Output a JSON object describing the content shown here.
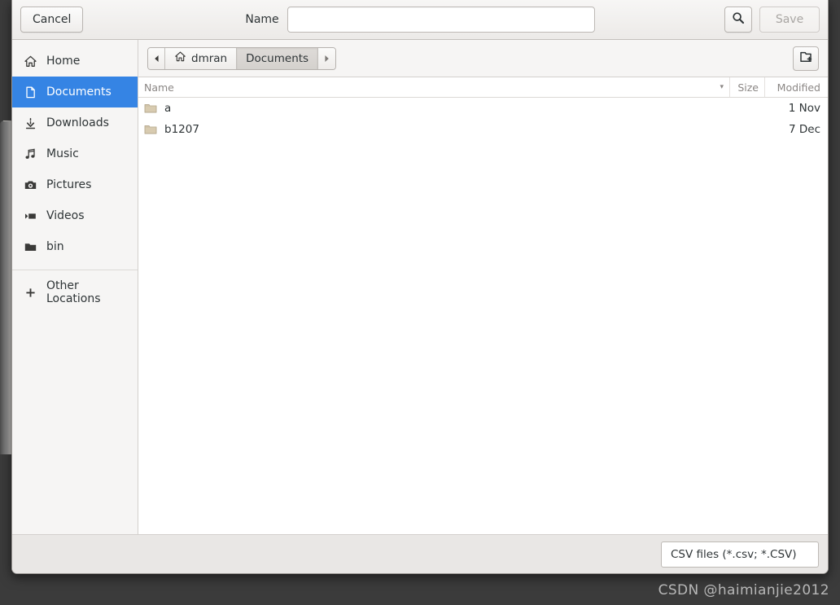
{
  "header": {
    "cancel_label": "Cancel",
    "name_label": "Name",
    "name_value": "",
    "name_placeholder": "",
    "search_icon": "search-icon",
    "save_label": "Save",
    "save_disabled": true
  },
  "sidebar": {
    "items": [
      {
        "label": "Home",
        "icon": "home-icon",
        "selected": false
      },
      {
        "label": "Documents",
        "icon": "document-icon",
        "selected": true
      },
      {
        "label": "Downloads",
        "icon": "download-icon",
        "selected": false
      },
      {
        "label": "Music",
        "icon": "music-note-icon",
        "selected": false
      },
      {
        "label": "Pictures",
        "icon": "camera-icon",
        "selected": false
      },
      {
        "label": "Videos",
        "icon": "video-icon",
        "selected": false
      },
      {
        "label": "bin",
        "icon": "folder-icon",
        "selected": false
      }
    ],
    "other_locations_label": "Other Locations",
    "other_locations_icon": "plus-icon"
  },
  "pathbar": {
    "back_icon": "triangle-left-icon",
    "forward_icon": "triangle-right-icon",
    "crumbs": [
      {
        "label": "dmran",
        "icon": "home-icon",
        "active": false
      },
      {
        "label": "Documents",
        "icon": "",
        "active": true
      }
    ],
    "new_folder_icon": "new-folder-icon"
  },
  "filelist": {
    "columns": {
      "name": "Name",
      "size": "Size",
      "modified": "Modified"
    },
    "sort_caret": "▾",
    "rows": [
      {
        "icon": "folder-icon",
        "name": "a",
        "size": "",
        "modified": "1 Nov"
      },
      {
        "icon": "folder-icon",
        "name": "b1207",
        "size": "",
        "modified": "7 Dec"
      }
    ]
  },
  "footer": {
    "filter_value": "CSV files (*.csv; *.CSV)"
  },
  "watermark": {
    "text": "CSDN @haimianjie2012"
  },
  "colors": {
    "accent": "#3584e4",
    "window_bg": "#f6f5f4",
    "list_bg": "#ffffff",
    "folder": "#d8cbb0",
    "text": "#2e3436",
    "muted_text": "#8b8785"
  }
}
